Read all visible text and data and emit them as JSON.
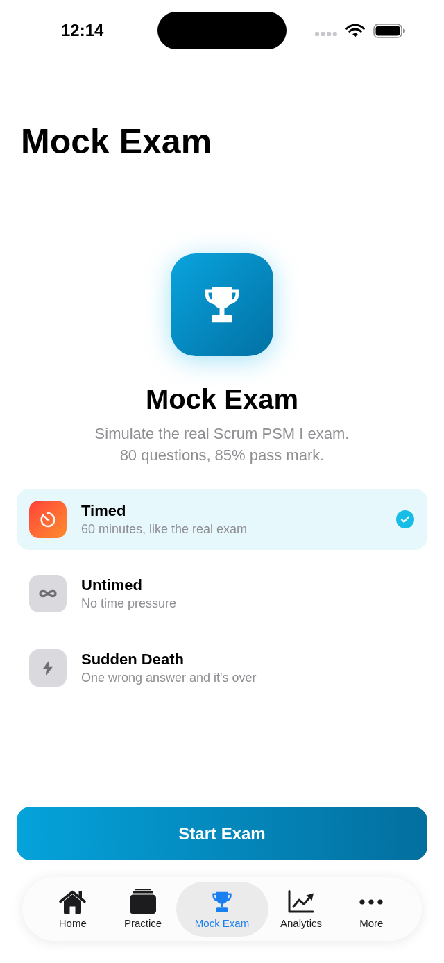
{
  "status_bar": {
    "time": "12:14"
  },
  "header": {
    "title": "Mock Exam"
  },
  "hero": {
    "title": "Mock Exam",
    "description": "Simulate the real Scrum PSM I exam.\n80 questions, 85% pass mark."
  },
  "modes": [
    {
      "kind": "timer",
      "title": "Timed",
      "subtitle": "60 minutes, like the real exam",
      "selected": true
    },
    {
      "kind": "infinity",
      "title": "Untimed",
      "subtitle": "No time pressure",
      "selected": false
    },
    {
      "kind": "bolt",
      "title": "Sudden Death",
      "subtitle": "One wrong answer and it's over",
      "selected": false
    }
  ],
  "start_button": {
    "label": "Start Exam"
  },
  "tab_bar": {
    "tabs": [
      {
        "kind": "home",
        "label": "Home",
        "selected": false
      },
      {
        "kind": "practice",
        "label": "Practice",
        "selected": false
      },
      {
        "kind": "mock",
        "label": "Mock Exam",
        "selected": true
      },
      {
        "kind": "analytics",
        "label": "Analytics",
        "selected": false
      },
      {
        "kind": "more",
        "label": "More",
        "selected": false
      }
    ]
  }
}
